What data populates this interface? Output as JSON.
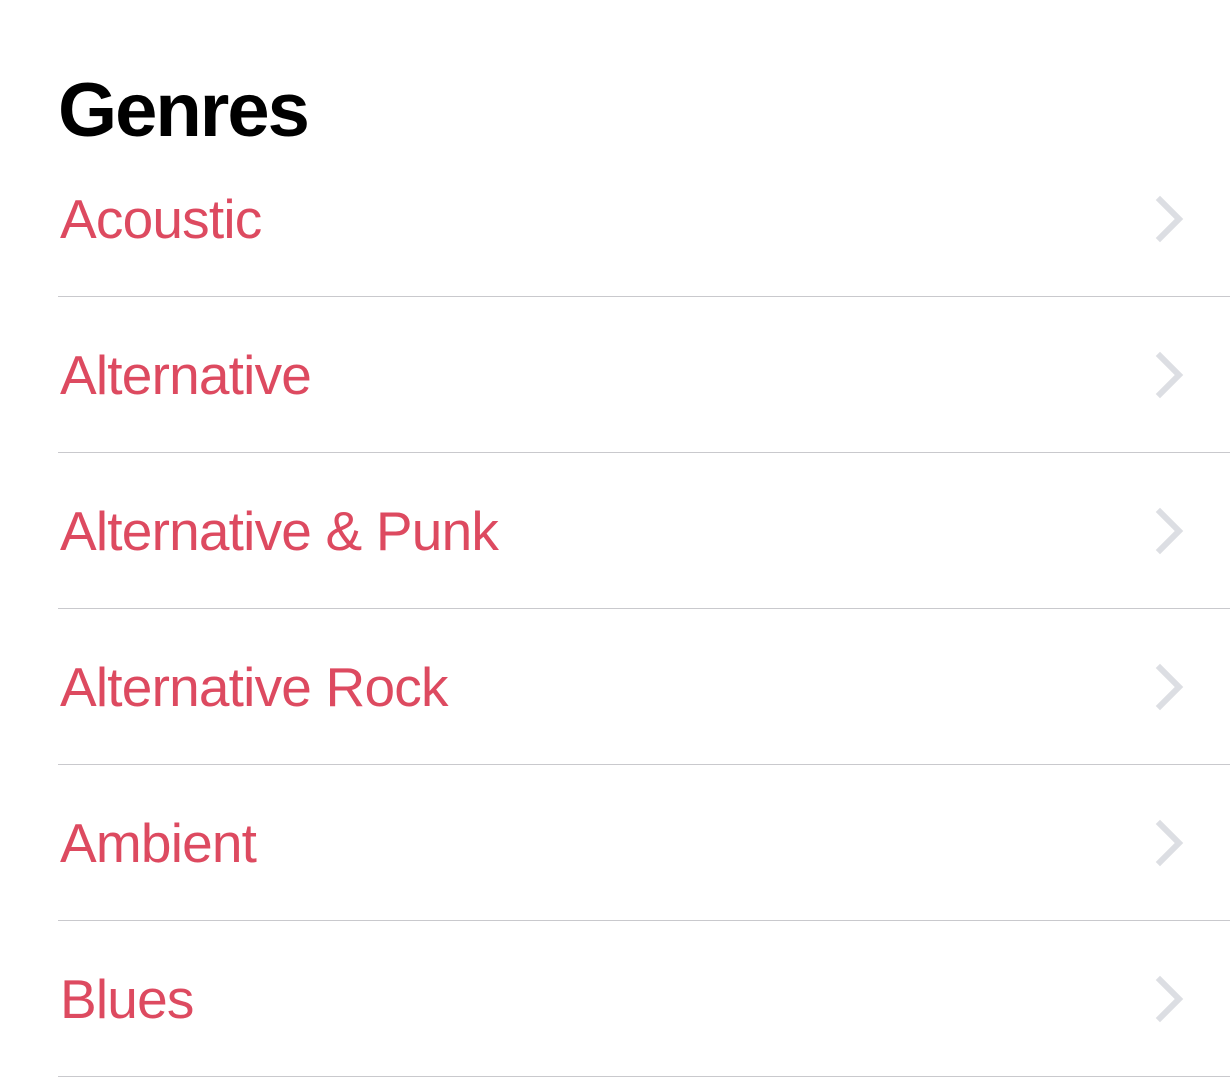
{
  "header": {
    "title": "Genres"
  },
  "colors": {
    "accent": "#dd4a60",
    "background": "#ffffff",
    "title": "#000000",
    "separator": "#c9c9cd",
    "chevron": "#dcdee3"
  },
  "list": {
    "name": "genres-list",
    "disclosure_icon": "chevron-right-icon",
    "items": [
      {
        "label": "Acoustic"
      },
      {
        "label": "Alternative"
      },
      {
        "label": "Alternative & Punk"
      },
      {
        "label": "Alternative Rock"
      },
      {
        "label": "Ambient"
      },
      {
        "label": "Blues"
      }
    ]
  }
}
